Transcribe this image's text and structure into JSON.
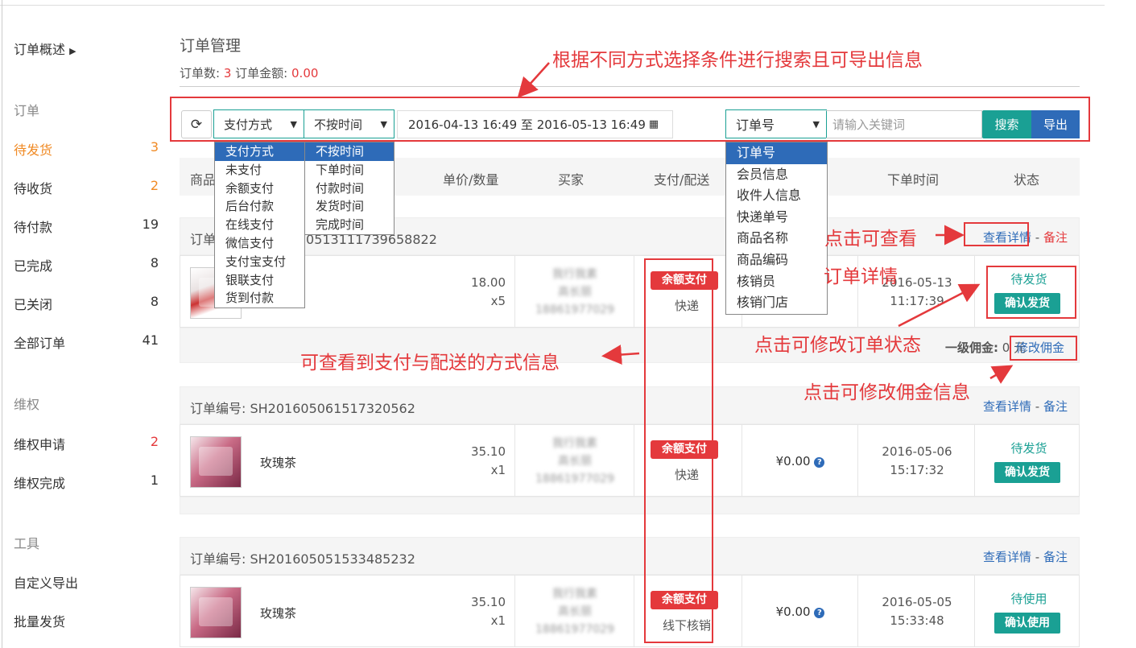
{
  "sidebar": {
    "overview": "订单概述",
    "section_orders": "订单",
    "items": [
      {
        "label": "待发货",
        "count": "3"
      },
      {
        "label": "待收货",
        "count": "2"
      },
      {
        "label": "待付款",
        "count": "19"
      },
      {
        "label": "已完成",
        "count": "8"
      },
      {
        "label": "已关闭",
        "count": "8"
      },
      {
        "label": "全部订单",
        "count": "41"
      }
    ],
    "section_rights": "维权",
    "rights": [
      {
        "label": "维权申请",
        "count": "2"
      },
      {
        "label": "维权完成",
        "count": "1"
      }
    ],
    "section_tools": "工具",
    "tools": [
      "自定义导出",
      "批量发货"
    ]
  },
  "page": {
    "title": "订单管理",
    "stats_orders_label": "订单数:",
    "stats_orders_value": "3",
    "stats_amount_label": "订单金额:",
    "stats_amount_value": "0.00"
  },
  "filters": {
    "pay_method": "支付方式",
    "time_type": "不按时间",
    "date_range": "2016-04-13 16:49 至 2016-05-13 16:49",
    "search_field": "订单号",
    "keyword_placeholder": "请输入关键词",
    "search_button": "搜索",
    "export_button": "导出",
    "pay_options": [
      "支付方式",
      "未支付",
      "余额支付",
      "后台付款",
      "在线支付",
      "微信支付",
      "支付宝支付",
      "银联支付",
      "货到付款"
    ],
    "time_options": [
      "不按时间",
      "下单时间",
      "付款时间",
      "发货时间",
      "完成时间"
    ],
    "field_options": [
      "订单号",
      "会员信息",
      "收件人信息",
      "快递单号",
      "商品名称",
      "商品编码",
      "核销员",
      "核销门店"
    ]
  },
  "table": {
    "headers": [
      "商品",
      "单价/数量",
      "买家",
      "支付/配送",
      "下单时间",
      "状态"
    ]
  },
  "orders": [
    {
      "number_label": "订单",
      "number_partial": "05131117396588​22",
      "view": "查看详情",
      "sep": "-",
      "note": "备注",
      "product": "",
      "price": "18.00",
      "qty": "x5",
      "buyer_1": "我行我素",
      "buyer_2": "高长丽",
      "buyer_3": "18861977029",
      "pay": "余额支付",
      "ship": "快递",
      "time_1": "2016-05-13",
      "time_2": "11:17:39",
      "status": "待发货",
      "action": "确认发货",
      "commission_label": "一级佣金:",
      "commission_value": "0 元",
      "commission_edit": "修改佣金"
    },
    {
      "number": "订单编号: SH201605061517320562",
      "view": "查看详情",
      "sep": "-",
      "note": "备注",
      "product": "玫瑰茶",
      "price": "35.10",
      "qty": "x1",
      "buyer_1": "我行我素",
      "buyer_2": "高长丽",
      "buyer_3": "18861977029",
      "pay": "余额支付",
      "ship": "快递",
      "commission": "¥0.00",
      "time_1": "2016-05-06",
      "time_2": "15:17:32",
      "status": "待发货",
      "action": "确认发货"
    },
    {
      "number": "订单编号: SH201605051533485232",
      "view": "查看详情",
      "sep": "-",
      "note": "备注",
      "product": "玫瑰茶",
      "price": "35.10",
      "qty": "x1",
      "buyer_1": "我行我素",
      "buyer_2": "高长丽",
      "buyer_3": "18861977029",
      "pay": "余额支付",
      "ship": "线下核销",
      "commission": "¥0.00",
      "time_1": "2016-05-05",
      "time_2": "15:33:48",
      "status": "待使用",
      "action": "确认使用"
    }
  ],
  "annotations": {
    "search_export": "根据不同方式选择条件进行搜索且可导出信息",
    "click_view": "点击可查看",
    "order_detail": "订单详情",
    "pay_ship_info": "可查看到支付与配送的方式信息",
    "modify_status": "点击可修改订单状态",
    "modify_commission": "点击可修改佣金信息",
    "color": "#e4393c"
  },
  "colors": {
    "accent": "#1aa094",
    "primary": "#2e6bb8",
    "danger": "#e4393c",
    "orange": "#f08a24"
  }
}
